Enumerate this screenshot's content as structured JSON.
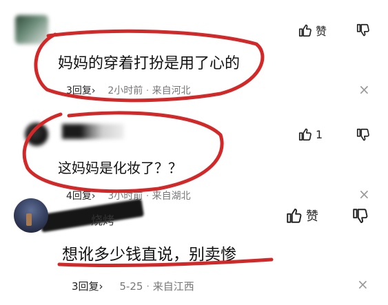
{
  "comments": [
    {
      "text": "妈妈的穿着打扮是用了心的",
      "replies": "3回复",
      "time": "2小时前",
      "location": "来自河北",
      "like_label": "赞"
    },
    {
      "text": "这妈妈是化妆了？？",
      "replies": "4回复",
      "time": "3小时前",
      "location": "来自湖北",
      "like_label": "1"
    },
    {
      "username_partial": "烧烤",
      "text": "想讹多少钱直说，别卖惨",
      "replies": "3回复",
      "time": "5-25",
      "location": "来自江西",
      "like_label": "赞"
    }
  ],
  "meta": {
    "separator": "·",
    "chevron": "›",
    "close": "×"
  },
  "colors": {
    "annotation_red": "#d42828",
    "meta_gray": "#777777"
  },
  "icons": [
    "thumbs-up-icon",
    "thumbs-down-icon",
    "close-icon",
    "chevron-right-icon"
  ]
}
